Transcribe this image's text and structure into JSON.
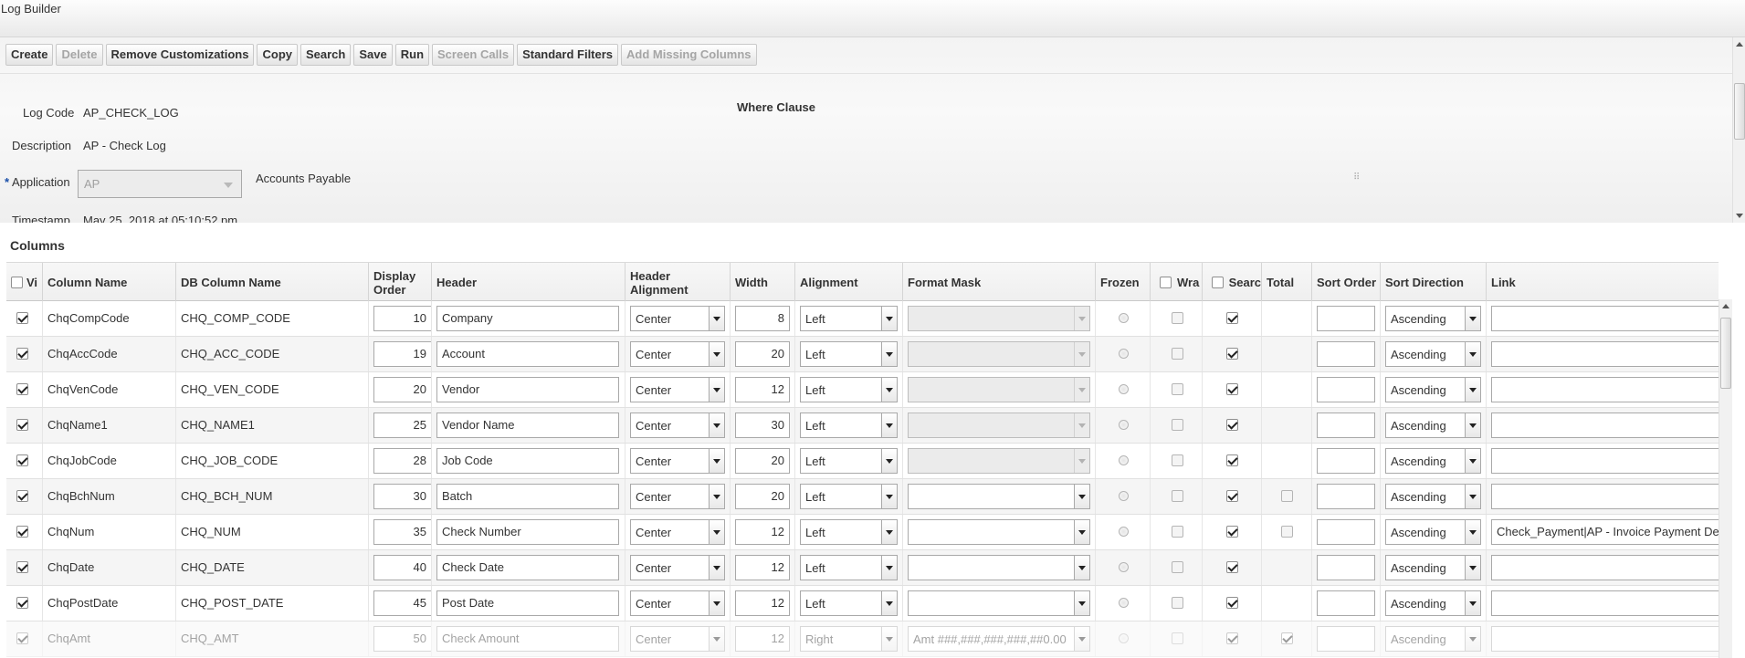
{
  "window": {
    "title": "Log Builder"
  },
  "toolbar": {
    "buttons": [
      {
        "label": "Create",
        "enabled": true
      },
      {
        "label": "Delete",
        "enabled": false
      },
      {
        "label": "Remove Customizations",
        "enabled": true
      },
      {
        "label": "Copy",
        "enabled": true
      },
      {
        "label": "Search",
        "enabled": true
      },
      {
        "label": "Save",
        "enabled": true
      },
      {
        "label": "Run",
        "enabled": true
      },
      {
        "label": "Screen Calls",
        "enabled": false
      },
      {
        "label": "Standard Filters",
        "enabled": true
      },
      {
        "label": "Add Missing Columns",
        "enabled": false
      }
    ]
  },
  "form": {
    "log_code_label": "Log Code",
    "log_code_value": "AP_CHECK_LOG",
    "description_label": "Description",
    "description_value": "AP - Check Log",
    "required_marker": "*",
    "application_label": "Application",
    "application_value": "AP",
    "application_name": "Accounts Payable",
    "where_clause_label": "Where Clause",
    "timestamp_label": "Timestamp",
    "timestamp_value": "May 25, 2018 at 05:10:52 pm"
  },
  "columns_section": {
    "title": "Columns",
    "headers": {
      "visible": "Vi",
      "column_name": "Column Name",
      "db_column_name": "DB Column Name",
      "display_order": "Display Order",
      "header": "Header",
      "header_alignment": "Header Alignment",
      "width": "Width",
      "alignment": "Alignment",
      "format_mask": "Format Mask",
      "frozen": "Frozen",
      "wrap": "Wra",
      "search": "Searc",
      "total": "Total",
      "sort_order": "Sort Order",
      "sort_direction": "Sort Direction",
      "link": "Link"
    },
    "rows": [
      {
        "visible": true,
        "column_name": "ChqCompCode",
        "db_column_name": "CHQ_COMP_CODE",
        "display_order": "10",
        "header": "Company",
        "header_alignment": "Center",
        "width": "8",
        "alignment": "Left",
        "format_mask": "",
        "format_mask_enabled": false,
        "frozen": false,
        "wrap": false,
        "search": true,
        "total": null,
        "sort_order": "",
        "sort_direction": "Ascending",
        "link": ""
      },
      {
        "visible": true,
        "column_name": "ChqAccCode",
        "db_column_name": "CHQ_ACC_CODE",
        "display_order": "19",
        "header": "Account",
        "header_alignment": "Center",
        "width": "20",
        "alignment": "Left",
        "format_mask": "",
        "format_mask_enabled": false,
        "frozen": false,
        "wrap": false,
        "search": true,
        "total": null,
        "sort_order": "",
        "sort_direction": "Ascending",
        "link": ""
      },
      {
        "visible": true,
        "column_name": "ChqVenCode",
        "db_column_name": "CHQ_VEN_CODE",
        "display_order": "20",
        "header": "Vendor",
        "header_alignment": "Center",
        "width": "12",
        "alignment": "Left",
        "format_mask": "",
        "format_mask_enabled": false,
        "frozen": false,
        "wrap": false,
        "search": true,
        "total": null,
        "sort_order": "",
        "sort_direction": "Ascending",
        "link": ""
      },
      {
        "visible": true,
        "column_name": "ChqName1",
        "db_column_name": "CHQ_NAME1",
        "display_order": "25",
        "header": "Vendor Name",
        "header_alignment": "Center",
        "width": "30",
        "alignment": "Left",
        "format_mask": "",
        "format_mask_enabled": false,
        "frozen": false,
        "wrap": false,
        "search": true,
        "total": null,
        "sort_order": "",
        "sort_direction": "Ascending",
        "link": ""
      },
      {
        "visible": true,
        "column_name": "ChqJobCode",
        "db_column_name": "CHQ_JOB_CODE",
        "display_order": "28",
        "header": "Job Code",
        "header_alignment": "Center",
        "width": "20",
        "alignment": "Left",
        "format_mask": "",
        "format_mask_enabled": false,
        "frozen": false,
        "wrap": false,
        "search": true,
        "total": null,
        "sort_order": "",
        "sort_direction": "Ascending",
        "link": ""
      },
      {
        "visible": true,
        "column_name": "ChqBchNum",
        "db_column_name": "CHQ_BCH_NUM",
        "display_order": "30",
        "header": "Batch",
        "header_alignment": "Center",
        "width": "20",
        "alignment": "Left",
        "format_mask": "",
        "format_mask_enabled": true,
        "frozen": false,
        "wrap": false,
        "search": true,
        "total": false,
        "sort_order": "",
        "sort_direction": "Ascending",
        "link": ""
      },
      {
        "visible": true,
        "column_name": "ChqNum",
        "db_column_name": "CHQ_NUM",
        "display_order": "35",
        "header": "Check Number",
        "header_alignment": "Center",
        "width": "12",
        "alignment": "Left",
        "format_mask": "",
        "format_mask_enabled": true,
        "frozen": false,
        "wrap": false,
        "search": true,
        "total": false,
        "sort_order": "",
        "sort_direction": "Ascending",
        "link": "Check_Payment|AP - Invoice Payment Detail"
      },
      {
        "visible": true,
        "column_name": "ChqDate",
        "db_column_name": "CHQ_DATE",
        "display_order": "40",
        "header": "Check Date",
        "header_alignment": "Center",
        "width": "12",
        "alignment": "Left",
        "format_mask": "",
        "format_mask_enabled": true,
        "frozen": false,
        "wrap": false,
        "search": true,
        "total": null,
        "sort_order": "",
        "sort_direction": "Ascending",
        "link": ""
      },
      {
        "visible": true,
        "column_name": "ChqPostDate",
        "db_column_name": "CHQ_POST_DATE",
        "display_order": "45",
        "header": "Post Date",
        "header_alignment": "Center",
        "width": "12",
        "alignment": "Left",
        "format_mask": "",
        "format_mask_enabled": true,
        "frozen": false,
        "wrap": false,
        "search": true,
        "total": null,
        "sort_order": "",
        "sort_direction": "Ascending",
        "link": ""
      },
      {
        "visible": true,
        "column_name": "ChqAmt",
        "db_column_name": "CHQ_AMT",
        "display_order": "50",
        "header": "Check Amount",
        "header_alignment": "Center",
        "width": "12",
        "alignment": "Right",
        "format_mask": "Amt ###,###,###,###,##0.00",
        "format_mask_enabled": true,
        "frozen": false,
        "wrap": false,
        "search": true,
        "total": true,
        "sort_order": "",
        "sort_direction": "Ascending",
        "link": "",
        "faded": true
      }
    ]
  }
}
